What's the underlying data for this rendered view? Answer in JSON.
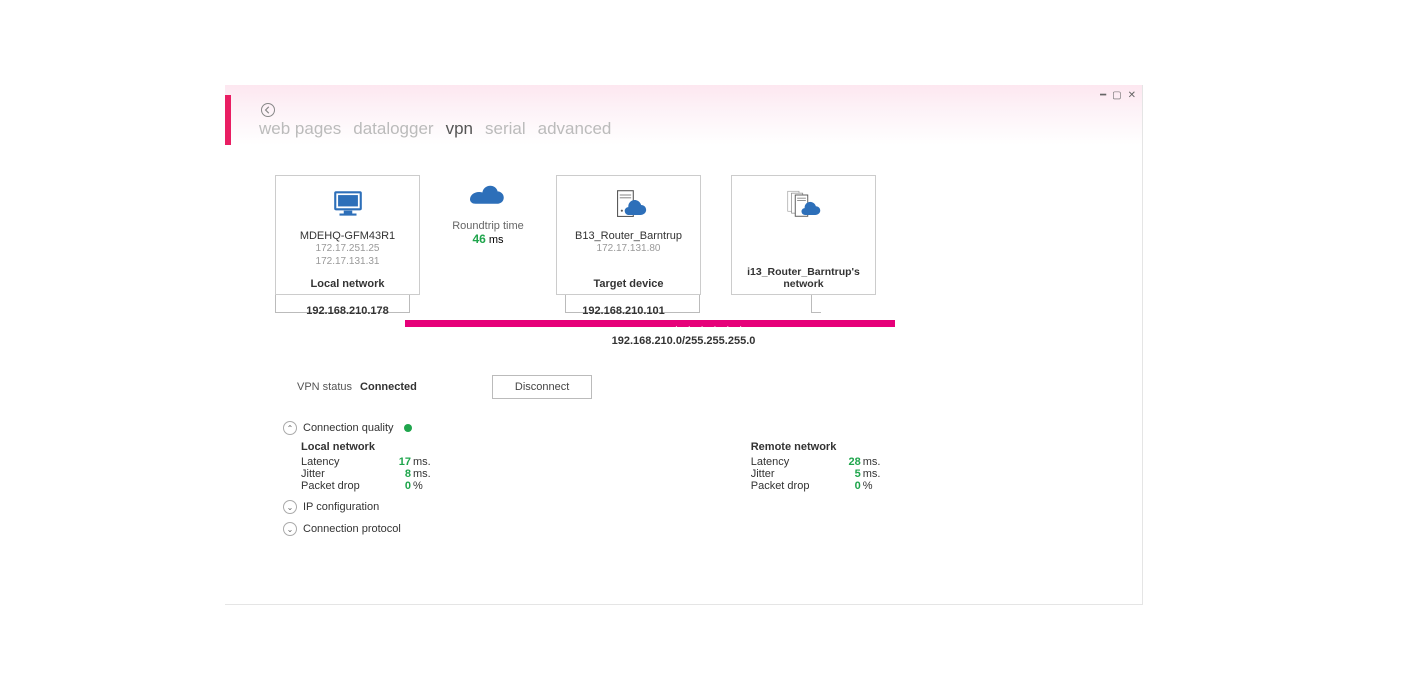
{
  "tabs": [
    "web pages",
    "datalogger",
    "vpn",
    "serial",
    "advanced"
  ],
  "active_tab": "vpn",
  "card_local": {
    "name": "MDEHQ-GFM43R1",
    "ip1": "172.17.251.25",
    "ip2": "172.17.131.31",
    "footer": "Local network"
  },
  "rtt": {
    "label": "Roundtrip time",
    "value": "46",
    "unit": "ms"
  },
  "card_target": {
    "name": "B13_Router_Barntrup",
    "ip1": "172.17.131.80",
    "footer": "Target device"
  },
  "card_remote": {
    "footer": "i13_Router_Barntrup's network"
  },
  "ip_local": "192.168.210.178",
  "ip_remote": "192.168.210.101",
  "subnet": "192.168.210.0/255.255.255.0",
  "vpn_status_label": "VPN status",
  "vpn_status_value": "Connected",
  "disconnect_label": "Disconnect",
  "conn_quality_label": "Connection quality",
  "ip_config_label": "IP configuration",
  "conn_protocol_label": "Connection protocol",
  "local_net_label": "Local network",
  "remote_net_label": "Remote network",
  "metrics": {
    "latency_label": "Latency",
    "jitter_label": "Jitter",
    "drop_label": "Packet drop",
    "ms": "ms.",
    "pct": "%"
  },
  "local": {
    "latency": "17",
    "jitter": "8",
    "drop": "0"
  },
  "remote": {
    "latency": "28",
    "jitter": "5",
    "drop": "0"
  }
}
